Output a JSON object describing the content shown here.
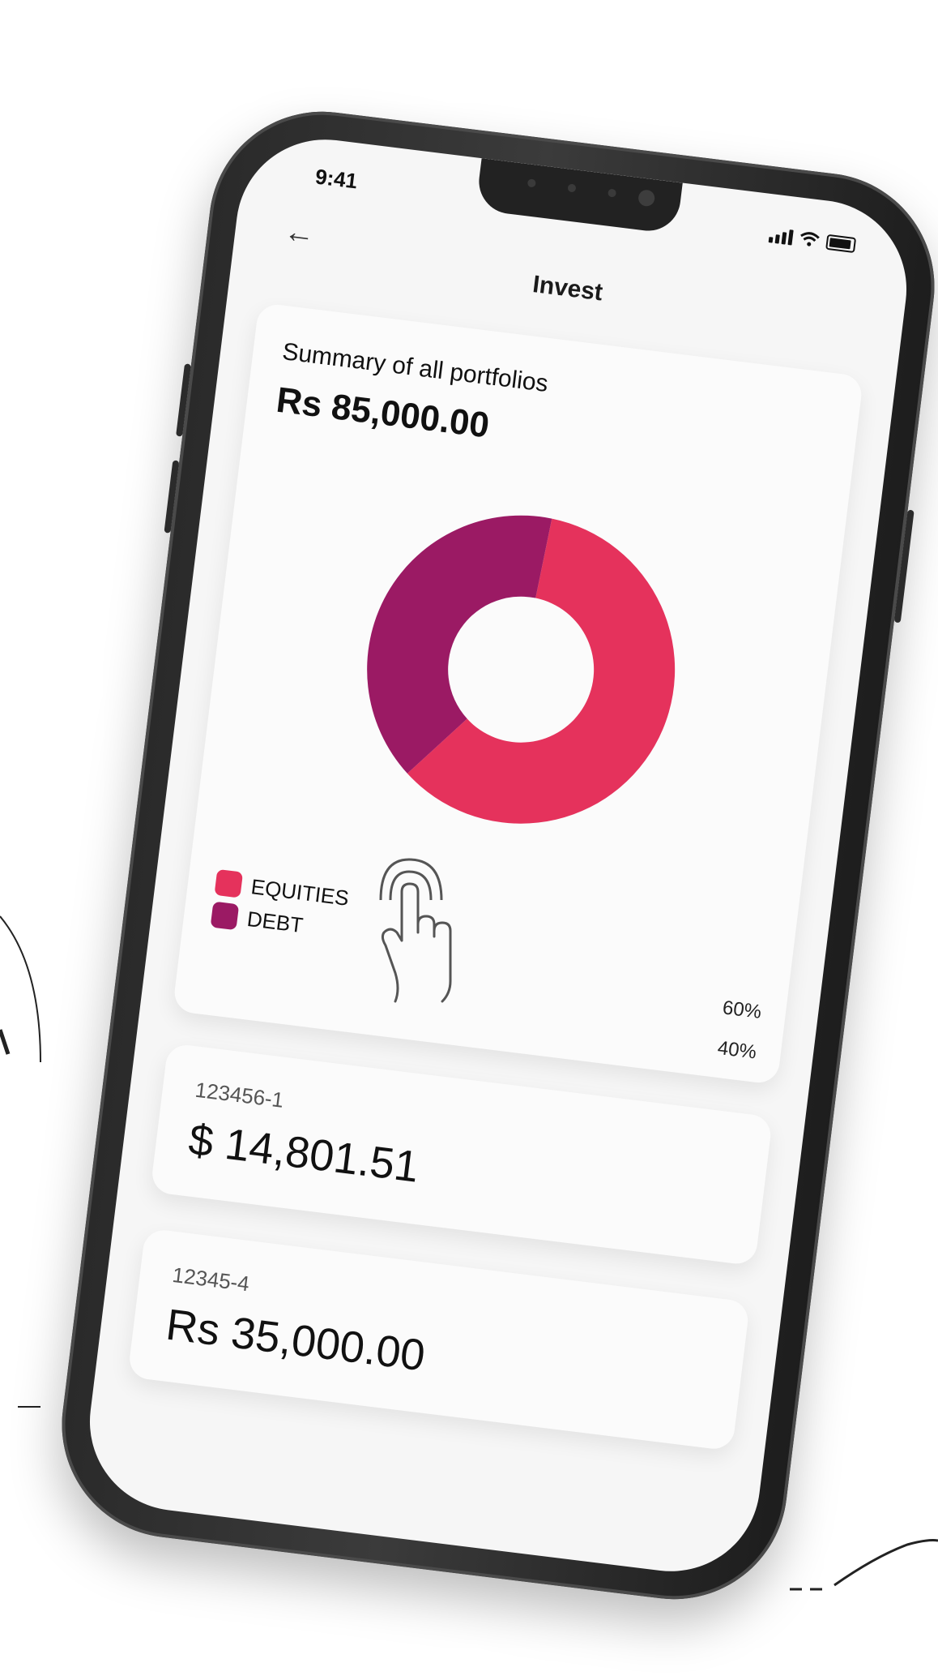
{
  "status_bar": {
    "time": "9:41"
  },
  "header": {
    "title": "Invest",
    "back_icon": "arrow-left-icon"
  },
  "summary": {
    "label": "Summary of all portfolios",
    "total": "Rs 85,000.00",
    "percentages": [
      "60%",
      "40%"
    ]
  },
  "chart_data": {
    "type": "pie",
    "categories": [
      "EQUITIES",
      "DEBT"
    ],
    "values": [
      60,
      40
    ],
    "colors": [
      "#e5325c",
      "#9b1a64"
    ]
  },
  "accounts": [
    {
      "id": "123456-1",
      "balance": "$ 14,801.51"
    },
    {
      "id": "12345-4",
      "balance": "Rs 35,000.00"
    }
  ],
  "colors": {
    "equities": "#e5325c",
    "debt": "#9b1a64"
  }
}
